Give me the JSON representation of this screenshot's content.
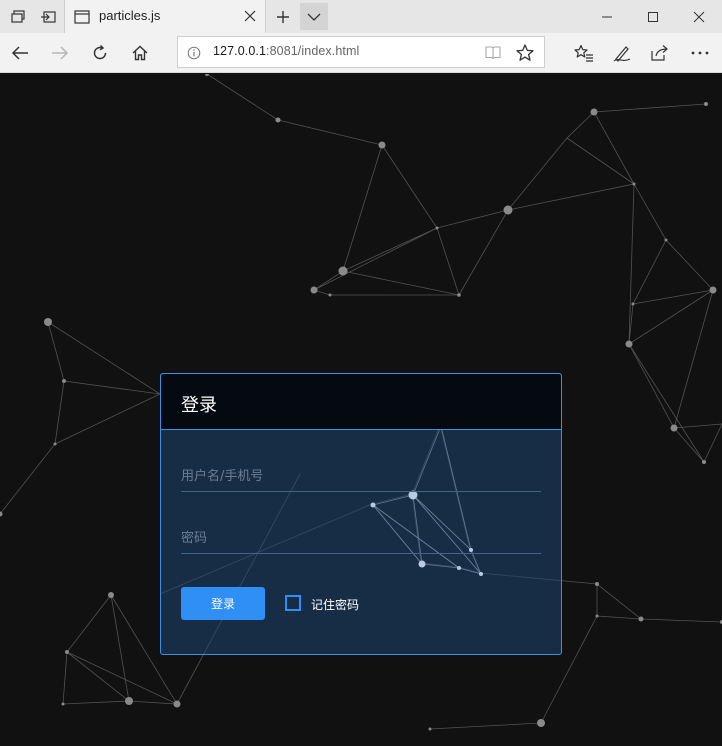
{
  "browser": {
    "tab_title": "particles.js",
    "address": {
      "host": "127.0.0.1",
      "rest": ":8081/index.html"
    }
  },
  "login": {
    "title": "登录",
    "username_placeholder": "用户名/手机号",
    "password_placeholder": "密码",
    "submit_label": "登录",
    "remember_label": "记住密码"
  },
  "colors": {
    "page_bg": "#111111",
    "accent": "#2f8ff5",
    "header_bg": "#050a10"
  }
}
